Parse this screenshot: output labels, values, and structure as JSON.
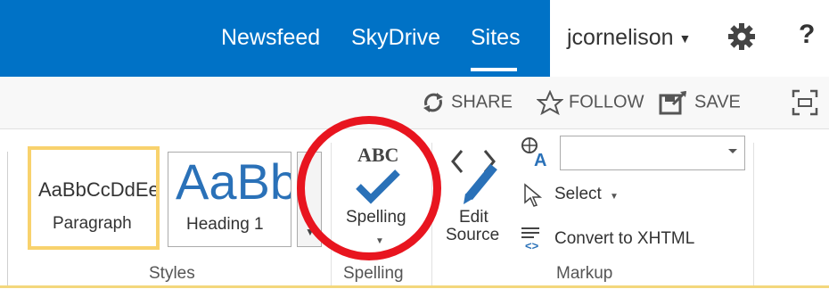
{
  "nav": {
    "newsfeed": "Newsfeed",
    "skydrive": "SkyDrive",
    "sites": "Sites",
    "user": "jcornelison",
    "help": "?"
  },
  "actions": {
    "share": "SHARE",
    "follow": "FOLLOW",
    "save": "SAVE"
  },
  "styles": {
    "paragraph_sample": "AaBbCcDdEe",
    "paragraph_name": "Paragraph",
    "heading_sample": "AaBb",
    "heading_name": "Heading 1",
    "group_label": "Styles"
  },
  "spelling": {
    "abc": "ABC",
    "label": "Spelling",
    "group_label": "Spelling"
  },
  "markup": {
    "edit_source_line1": "Edit",
    "edit_source_line2": "Source",
    "select_label": "Select",
    "convert_label": "Convert to XHTML",
    "language_value": "",
    "group_label": "Markup"
  },
  "colors": {
    "suite_blue": "#0072c6",
    "highlight": "#e8151f",
    "accent": "#2a71b8",
    "selected_style": "#f8d26d"
  },
  "icons": [
    "gear-icon",
    "share-icon",
    "star-icon",
    "save-icon",
    "focus-icon",
    "checkmark-icon",
    "edit-source-icon",
    "language-icon",
    "cursor-icon",
    "convert-xhtml-icon"
  ]
}
